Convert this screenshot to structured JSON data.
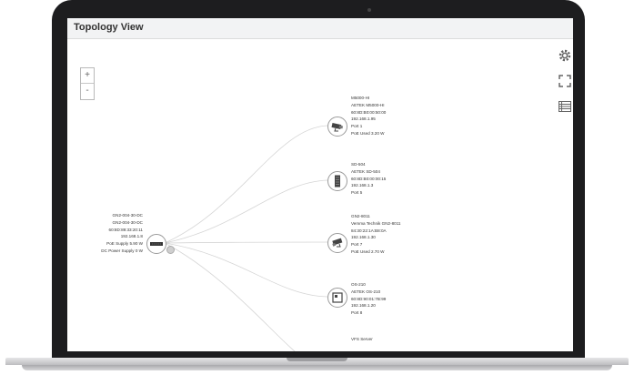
{
  "app": {
    "title": "Topology View"
  },
  "zoom": {
    "in_label": "+",
    "out_label": "-"
  },
  "toolbar": {
    "icons": [
      "gear-icon",
      "fullscreen-icon",
      "list-view-icon"
    ]
  },
  "hub": {
    "icon": "switch-icon",
    "lines": [
      "GN2-004-30-DC",
      "GN2-004-30-DC",
      "60:8D:89:33:20:11",
      "192.168.1.8",
      "PoE Supply 5.90 W",
      "DC Power Supply 0 W"
    ]
  },
  "devices": [
    {
      "icon": "camera-icon",
      "lines": [
        "M5000-HI",
        "AETEK M5000-HI",
        "60:8D:B0:00:50:00",
        "192.168.1.95",
        "Port 1",
        "PoE Used 3.20 W"
      ]
    },
    {
      "icon": "server-icon",
      "lines": [
        "SD-504",
        "AETEK SD-504",
        "60:8D:B0:00:00:15",
        "192.168.1.3",
        "Port 5"
      ]
    },
    {
      "icon": "camera-icon",
      "lines": [
        "GN2-8011",
        "Vemma Technik GN2-8011",
        "84:30:22:1A:B8:0A",
        "192.168.1.30",
        "Port 7",
        "PoE Used 2.70 W"
      ]
    },
    {
      "icon": "display-icon",
      "lines": [
        "OS-210",
        "AETEK OS-210",
        "60:8D:90:01:7B:99",
        "192.168.1.20",
        "Port 8"
      ]
    },
    {
      "lines": [
        "VFS Server"
      ]
    }
  ]
}
